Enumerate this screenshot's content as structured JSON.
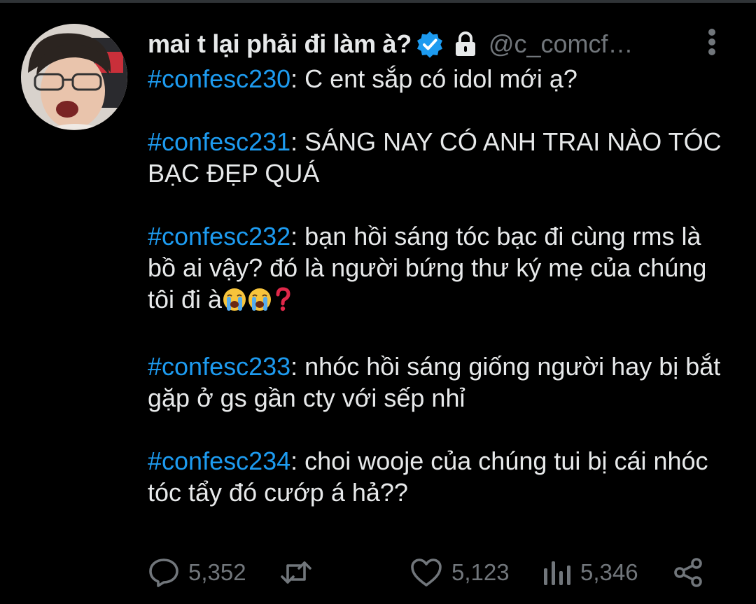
{
  "tweet": {
    "display_name": "mai t lại phải đi làm à?",
    "handle": "@c_comcf…",
    "verified": true,
    "protected": true,
    "accent_color": "#1d9bf0",
    "entries": [
      {
        "hashtag": "#confesc230",
        "text": ": C ent sắp có idol mới ạ?"
      },
      {
        "hashtag": "#confesc231",
        "text": ": SÁNG NAY CÓ ANH TRAI NÀO TÓC BẠC ĐẸP QUÁ"
      },
      {
        "hashtag": "#confesc232",
        "text": ": bạn hồi sáng tóc bạc đi cùng rms là bồ ai vậy? đó là người bứng thư ký mẹ của chúng tôi đi à"
      },
      {
        "hashtag": "#confesc233",
        "text": ": nhóc hồi sáng giống người hay bị bắt gặp ở gs gần cty với sếp nhỉ"
      },
      {
        "hashtag": "#confesc234",
        "text": ": choi wooje của chúng tui bị cái nhóc tóc tẩy đó cướp á hả??"
      }
    ],
    "entry3_emojis": [
      "loudly-crying-face",
      "loudly-crying-face",
      "red-question-mark"
    ],
    "actions": {
      "replies": "5,352",
      "retweets": "",
      "likes": "5,123",
      "views": "5,346"
    }
  }
}
